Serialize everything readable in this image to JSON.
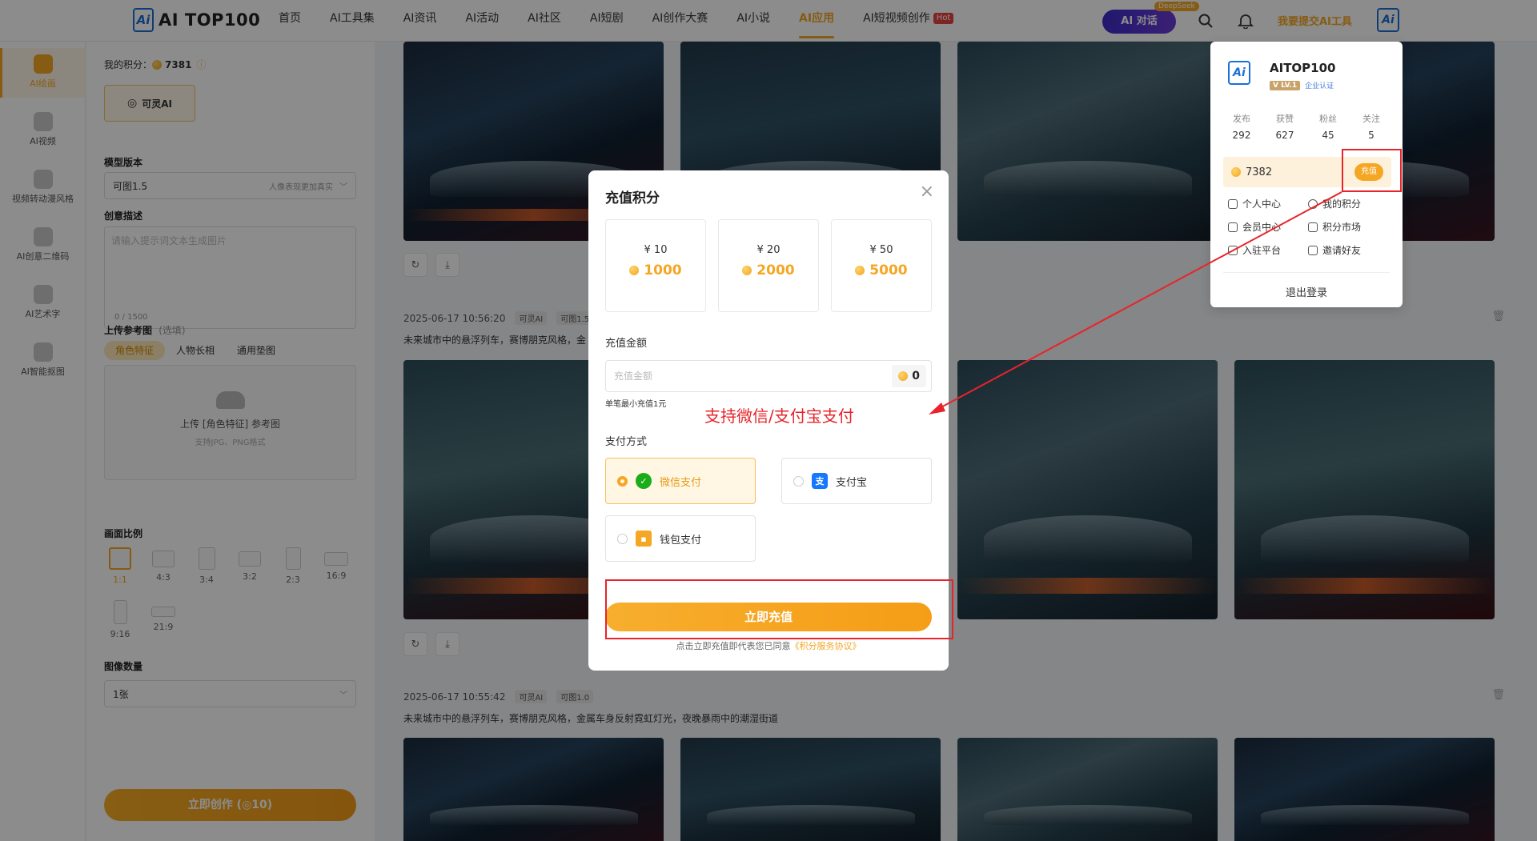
{
  "nav": {
    "logo_text": "AI TOP100",
    "logo_mark": "Ai",
    "items": [
      "首页",
      "AI工具集",
      "AI资讯",
      "AI活动",
      "AI社区",
      "AI短剧",
      "AI创作大赛",
      "AI小说",
      "AI应用",
      "AI短视频创作"
    ],
    "hot_tag": "Hot",
    "ai_chat": "AI 对话",
    "deepseek_tag": "DeepSeek",
    "submit_tool": "我要提交AI工具"
  },
  "iconbar": {
    "items": [
      "AI绘画",
      "AI视频",
      "视频转动漫风格",
      "AI创意二维码",
      "AI艺术字",
      "AI智能抠图"
    ]
  },
  "form": {
    "points_label": "我的积分：",
    "points_value": "7381",
    "model_btn": "可灵AI",
    "model_version_label": "模型版本",
    "model_version_value": "可图1.5",
    "model_version_hint": "人像表现更加真实",
    "desc_label": "创意描述",
    "desc_placeholder": "请输入提示词文本生成图片",
    "desc_count": "0 / 1500",
    "ref_label": "上传参考图",
    "ref_optional": "(选填)",
    "ref_tabs": [
      "角色特征",
      "人物长相",
      "通用垫图"
    ],
    "upload_title": "上传 [角色特征] 参考图",
    "upload_sub": "支持JPG、PNG格式",
    "ratio_label": "画面比例",
    "ratios": [
      "1:1",
      "4:3",
      "3:4",
      "3:2",
      "2:3",
      "16:9",
      "9:16",
      "21:9"
    ],
    "count_label": "图像数量",
    "count_value": "1张",
    "create_btn": "立即创作 (◎10)"
  },
  "feed": {
    "group2_time": "2025-06-17 10:56:20",
    "group2_tag1": "可灵AI",
    "group2_tag2": "可图1.5",
    "group2_prompt": "未来城市中的悬浮列车，赛博朋克风格，金",
    "group3_time": "2025-06-17 10:55:42",
    "group3_tag1": "可灵AI",
    "group3_tag2": "可图1.0",
    "group3_prompt": "未来城市中的悬浮列车，赛博朋克风格，金属车身反射霓虹灯光，夜晚暴雨中的潮湿街道"
  },
  "usercard": {
    "avatar": "Ai",
    "name": "AITOP100",
    "badge_v": "V LV.1",
    "badge_ent": "企业认证",
    "stats": [
      {
        "k": "发布",
        "v": "292"
      },
      {
        "k": "获赞",
        "v": "627"
      },
      {
        "k": "粉丝",
        "v": "45"
      },
      {
        "k": "关注",
        "v": "5"
      }
    ],
    "points": "7382",
    "recharge": "充值",
    "menu": [
      "个人中心",
      "我的积分",
      "会员中心",
      "积分市场",
      "入驻平台",
      "邀请好友"
    ],
    "logout": "退出登录"
  },
  "modal": {
    "title": "充值积分",
    "close": "×",
    "packages": [
      {
        "price": "¥ 10",
        "points": "1000"
      },
      {
        "price": "¥ 20",
        "points": "2000"
      },
      {
        "price": "¥ 50",
        "points": "5000"
      }
    ],
    "amount_label": "充值金额",
    "amount_placeholder": "充值金额",
    "amount_value": "0",
    "min_note": "单笔最小充值1元",
    "pay_label": "支付方式",
    "pay_wechat": "微信支付",
    "pay_alipay": "支付宝",
    "pay_wallet": "钱包支付",
    "confirm": "立即充值",
    "agree_text": "点击立即充值即代表您已同意",
    "agree_link": "《积分服务协议》"
  },
  "annotation": {
    "text": "支持微信/支付宝支付"
  },
  "colors": {
    "accent": "#f5a623",
    "annotation_red": "#e8242a"
  }
}
